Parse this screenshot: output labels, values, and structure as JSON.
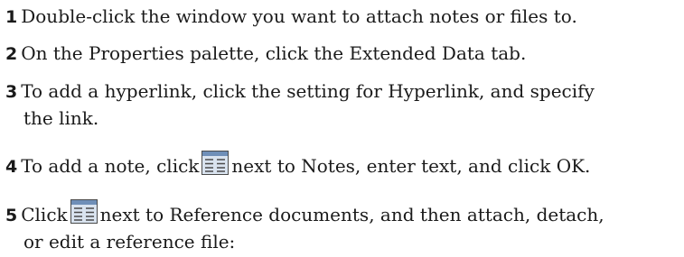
{
  "steps": [
    {
      "number": "1",
      "text": "Double-click the window you want to attach notes or files to."
    },
    {
      "number": "2",
      "text": "On the Properties palette, click the Extended Data tab."
    },
    {
      "number": "3",
      "line1": "To add a hyperlink, click the setting for Hyperlink, and specify",
      "line2": "the link."
    },
    {
      "number": "4",
      "before": "To add a note, click",
      "after": "next to Notes, enter text, and click OK.",
      "icon": "browse-button-icon"
    },
    {
      "number": "5",
      "before": "Click",
      "after": "next to Reference documents, and then attach, detach,",
      "line2": "or edit a reference file:",
      "icon": "browse-button-icon"
    }
  ],
  "colors": {
    "text": "#1a1a1a",
    "icon_frame": "#4a4a4a",
    "icon_header": "#6f8fb8",
    "icon_body": "#d9e3ef"
  }
}
